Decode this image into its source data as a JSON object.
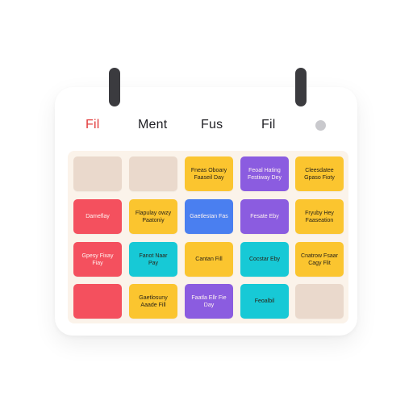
{
  "header": {
    "days": [
      "Fil",
      "Ment",
      "Fus",
      "Fil"
    ]
  },
  "colors": {
    "highlight": "#e23b3b",
    "empty": "#ead9cc",
    "yellow": "#fbc52f",
    "purple": "#8b5ce0",
    "blue": "#4a7ff0",
    "red": "#f4505e",
    "cyan": "#17c9d6"
  },
  "grid": {
    "rows": [
      [
        {
          "color": "empty",
          "text": ""
        },
        {
          "color": "empty",
          "text": ""
        },
        {
          "color": "yellow",
          "text": "Fneas Oboary Faaseil Day"
        },
        {
          "color": "purple",
          "text": "Feoal Hating Festiway Dey"
        },
        {
          "color": "yellow",
          "text": "Cleesdatee Gpaso Fioty"
        }
      ],
      [
        {
          "color": "red",
          "text": "Dameflay"
        },
        {
          "color": "yellow",
          "text": "Flapulay owzy Paatoniy"
        },
        {
          "color": "blue",
          "text": "Gaetlestan Fas"
        },
        {
          "color": "purple",
          "text": "Fesate Eby"
        },
        {
          "color": "yellow",
          "text": "Fryuby Hey Faaseation"
        }
      ],
      [
        {
          "color": "red",
          "text": "Gpesy Fixay Fiay"
        },
        {
          "color": "cyan",
          "text": "Fanot Naar Pay"
        },
        {
          "color": "yellow",
          "text": "Cantan Fill"
        },
        {
          "color": "cyan",
          "text": "Cocstar Eby"
        },
        {
          "color": "yellow",
          "text": "Cnatrow Fsaar Cagy Flit"
        }
      ],
      [
        {
          "color": "red",
          "text": ""
        },
        {
          "color": "yellow",
          "text": "Gaetlosuny Aaade Fill"
        },
        {
          "color": "purple",
          "text": "Faatla Ellr Fie Day"
        },
        {
          "color": "cyan",
          "text": "Feoalbil"
        },
        {
          "color": "empty",
          "text": ""
        }
      ]
    ]
  }
}
